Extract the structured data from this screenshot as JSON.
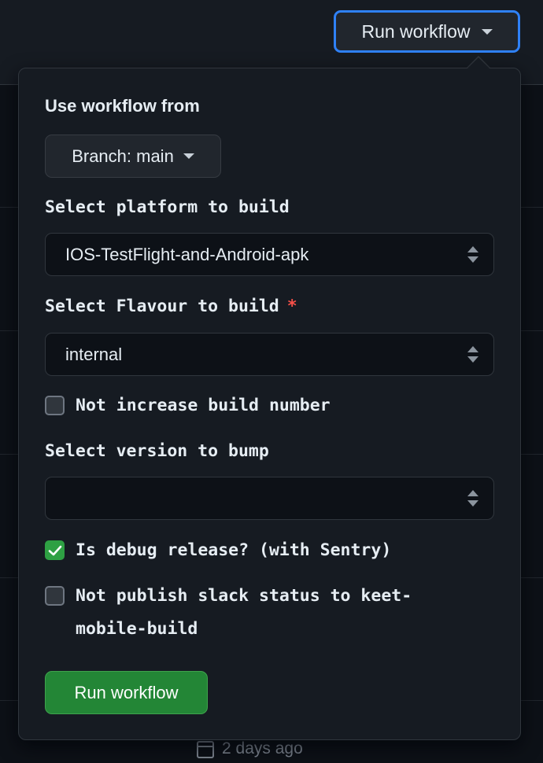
{
  "header": {
    "run_workflow_label": "Run workflow"
  },
  "background": {
    "footer_time": "2 days ago"
  },
  "popover": {
    "use_workflow_from": "Use workflow from",
    "branch_label": "Branch: main",
    "platform": {
      "label": "Select platform to build",
      "value": "IOS-TestFlight-and-Android-apk"
    },
    "flavour": {
      "label": "Select Flavour to build",
      "required_marker": "*",
      "value": "internal"
    },
    "not_increase_build": {
      "label": "Not increase build number",
      "checked": false
    },
    "version_bump": {
      "label": "Select version to bump",
      "value": ""
    },
    "debug_release": {
      "label": "Is debug release? (with Sentry)",
      "checked": true
    },
    "not_publish_slack": {
      "label_line1": "Not publish slack status to keet-",
      "label_line2": "mobile-build",
      "checked": false
    },
    "run_button_label": "Run workflow"
  },
  "colors": {
    "accent_blue": "#2f81f7",
    "primary_green": "#238636",
    "required_red": "#f85149"
  },
  "icons": [
    "caret-down-icon",
    "select-arrows-icon",
    "checkmark-icon",
    "calendar-icon"
  ]
}
